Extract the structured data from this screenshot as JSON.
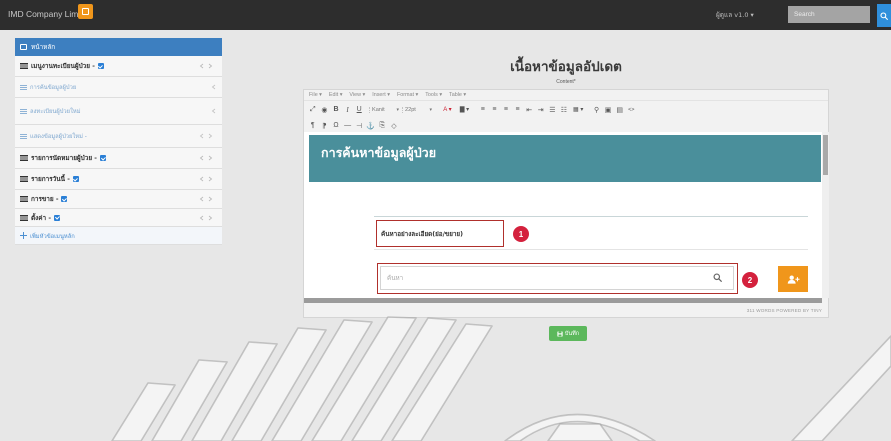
{
  "topbar": {
    "company": "IMD Company Limited",
    "user_menu": "ผู้ดูแล v1.0 ▾",
    "search_placeholder": "Search"
  },
  "sidebar": {
    "home": "หน้าหลัก",
    "items": [
      {
        "label": "เมนูงานทะเบียนผู้ป่วย -"
      },
      {
        "label": "การค้นข้อมูลผู้ป่วย"
      },
      {
        "label": "ลงทะเบียนผู้ป่วยใหม่"
      },
      {
        "label": "แสดงข้อมูลผู้ป่วยใหม่ -"
      },
      {
        "label": "รายการนัดหมายผู้ป่วย -"
      },
      {
        "label": "รายการวันนี้ -"
      },
      {
        "label": "การขาย -"
      },
      {
        "label": "ตั้งค่า -"
      }
    ],
    "add_item": "เพิ่มหัวข้อเมนูหลัก"
  },
  "page": {
    "title": "เนื้อหาข้อมูลอัปเดต",
    "field_label": "Content*",
    "save_label": "บันทึก"
  },
  "editor": {
    "menu": [
      "File",
      "Edit",
      "View",
      "Insert",
      "Format",
      "Tools",
      "Table"
    ],
    "toolbar_rows": [
      [
        {
          "icon": "fullscreen-icon",
          "glyph": "⤢"
        },
        {
          "icon": "preview-icon",
          "glyph": "◉"
        },
        {
          "icon": "bold-icon",
          "glyph": "B"
        },
        {
          "icon": "italic-icon",
          "glyph": "I"
        },
        {
          "icon": "underline-icon",
          "glyph": "U"
        },
        {
          "icon": "font-family-select",
          "glyph": "Kanit"
        },
        {
          "icon": "font-size-select",
          "glyph": "22pt"
        },
        {
          "icon": "text-color-icon",
          "glyph": "A ▾"
        },
        {
          "icon": "background-color-icon",
          "glyph": "▇ ▾"
        },
        {
          "icon": "align-left-icon",
          "glyph": "≡"
        },
        {
          "icon": "align-center-icon",
          "glyph": "≡"
        },
        {
          "icon": "align-right-icon",
          "glyph": "≡"
        },
        {
          "icon": "align-justify-icon",
          "glyph": "≡"
        },
        {
          "icon": "outdent-icon",
          "glyph": "⇤"
        },
        {
          "icon": "indent-icon",
          "glyph": "⇥"
        },
        {
          "icon": "bullet-list-icon",
          "glyph": "☰"
        },
        {
          "icon": "numbered-list-icon",
          "glyph": "☷"
        },
        {
          "icon": "table-icon",
          "glyph": "▦ ▾"
        },
        {
          "icon": "link-icon",
          "glyph": "⚲"
        },
        {
          "icon": "image-icon",
          "glyph": "▣"
        },
        {
          "icon": "media-icon",
          "glyph": "▤"
        },
        {
          "icon": "code-icon",
          "glyph": "<>"
        }
      ],
      [
        {
          "icon": "ltr-icon",
          "glyph": "¶"
        },
        {
          "icon": "rtl-icon",
          "glyph": "⁋"
        },
        {
          "icon": "special-char-icon",
          "glyph": "Ω"
        },
        {
          "icon": "horizontal-rule-icon",
          "glyph": "—"
        },
        {
          "icon": "page-break-icon",
          "glyph": "⊣"
        },
        {
          "icon": "anchor-icon",
          "glyph": "⚓"
        },
        {
          "icon": "template-icon",
          "glyph": "⎘"
        },
        {
          "icon": "code-sample-icon",
          "glyph": "◇"
        }
      ]
    ],
    "heading": "การค้นหาข้อมูลผู้ป่วย",
    "advanced_toggle": "ค้นหาอย่างละเอียด(ย่อ/ขยาย)",
    "search_placeholder": "ค้นหา",
    "status": "311 WORDS POWERED BY TINY"
  },
  "callouts": [
    "1",
    "2"
  ],
  "colors": {
    "brand": "#3d7fc0",
    "orange": "#f0961b",
    "teal": "#4a8f9b",
    "callout": "#d4213d",
    "green": "#5cb85c",
    "frame": "#b0302c"
  }
}
